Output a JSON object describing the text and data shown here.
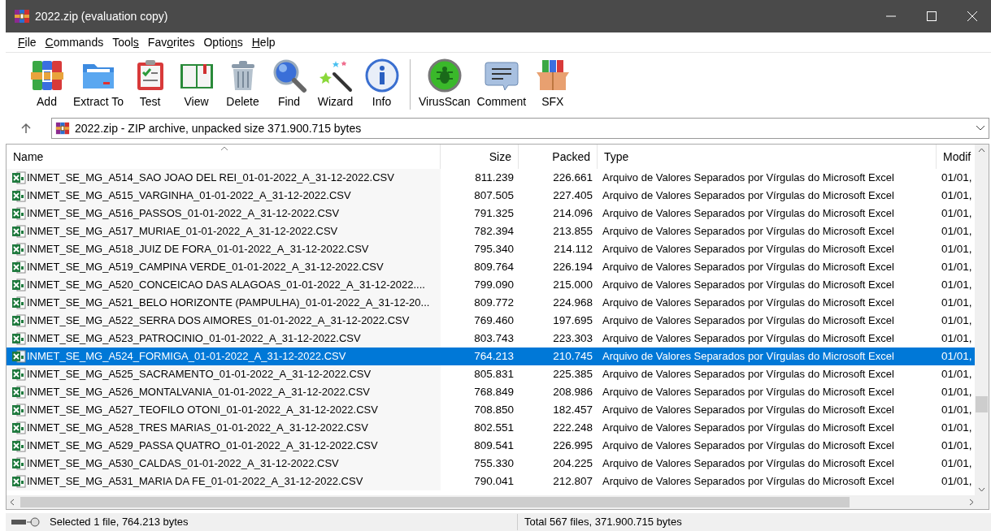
{
  "window": {
    "title": "2022.zip (evaluation copy)"
  },
  "menu": [
    {
      "key": "F",
      "after": "ile"
    },
    {
      "key": "C",
      "after": "ommands"
    },
    {
      "before": "Tool",
      "key": "s"
    },
    {
      "before": "Fav",
      "key": "o",
      "after": "rites"
    },
    {
      "before": "Optio",
      "key": "n",
      "after": "s"
    },
    {
      "key": "H",
      "after": "elp"
    }
  ],
  "toolbar": [
    {
      "kind": "add",
      "label": "Add"
    },
    {
      "kind": "extract",
      "label": "Extract To"
    },
    {
      "kind": "test",
      "label": "Test"
    },
    {
      "kind": "view",
      "label": "View"
    },
    {
      "kind": "delete",
      "label": "Delete"
    },
    {
      "kind": "find",
      "label": "Find"
    },
    {
      "kind": "wizard",
      "label": "Wizard"
    },
    {
      "kind": "info",
      "label": "Info"
    },
    {
      "kind": "separator"
    },
    {
      "kind": "virusscan",
      "label": "VirusScan"
    },
    {
      "kind": "comment",
      "label": "Comment"
    },
    {
      "kind": "sfx",
      "label": "SFX"
    }
  ],
  "address": {
    "text": "2022.zip - ZIP archive, unpacked size 371.900.715 bytes"
  },
  "table": {
    "columns": [
      "Name",
      "Size",
      "Packed",
      "Type",
      "Modif"
    ],
    "rows": [
      {
        "name": "INMET_SE_MG_A514_SAO JOAO DEL REI_01-01-2022_A_31-12-2022.CSV",
        "size": "811.239",
        "packed": "226.661",
        "type": "Arquivo de Valores Separados por Vírgulas do Microsoft Excel",
        "modified": "01/01,",
        "selected": false
      },
      {
        "name": "INMET_SE_MG_A515_VARGINHA_01-01-2022_A_31-12-2022.CSV",
        "size": "807.505",
        "packed": "227.405",
        "type": "Arquivo de Valores Separados por Vírgulas do Microsoft Excel",
        "modified": "01/01,",
        "selected": false
      },
      {
        "name": "INMET_SE_MG_A516_PASSOS_01-01-2022_A_31-12-2022.CSV",
        "size": "791.325",
        "packed": "214.096",
        "type": "Arquivo de Valores Separados por Vírgulas do Microsoft Excel",
        "modified": "01/01,",
        "selected": false
      },
      {
        "name": "INMET_SE_MG_A517_MURIAE_01-01-2022_A_31-12-2022.CSV",
        "size": "782.394",
        "packed": "213.855",
        "type": "Arquivo de Valores Separados por Vírgulas do Microsoft Excel",
        "modified": "01/01,",
        "selected": false
      },
      {
        "name": "INMET_SE_MG_A518_JUIZ DE FORA_01-01-2022_A_31-12-2022.CSV",
        "size": "795.340",
        "packed": "214.112",
        "type": "Arquivo de Valores Separados por Vírgulas do Microsoft Excel",
        "modified": "01/01,",
        "selected": false
      },
      {
        "name": "INMET_SE_MG_A519_CAMPINA VERDE_01-01-2022_A_31-12-2022.CSV",
        "size": "809.764",
        "packed": "226.194",
        "type": "Arquivo de Valores Separados por Vírgulas do Microsoft Excel",
        "modified": "01/01,",
        "selected": false
      },
      {
        "name": "INMET_SE_MG_A520_CONCEICAO DAS ALAGOAS_01-01-2022_A_31-12-2022....",
        "size": "799.090",
        "packed": "215.000",
        "type": "Arquivo de Valores Separados por Vírgulas do Microsoft Excel",
        "modified": "01/01,",
        "selected": false
      },
      {
        "name": "INMET_SE_MG_A521_BELO HORIZONTE (PAMPULHA)_01-01-2022_A_31-12-20...",
        "size": "809.772",
        "packed": "224.968",
        "type": "Arquivo de Valores Separados por Vírgulas do Microsoft Excel",
        "modified": "01/01,",
        "selected": false
      },
      {
        "name": "INMET_SE_MG_A522_SERRA DOS AIMORES_01-01-2022_A_31-12-2022.CSV",
        "size": "769.460",
        "packed": "197.695",
        "type": "Arquivo de Valores Separados por Vírgulas do Microsoft Excel",
        "modified": "01/01,",
        "selected": false
      },
      {
        "name": "INMET_SE_MG_A523_PATROCINIO_01-01-2022_A_31-12-2022.CSV",
        "size": "803.743",
        "packed": "223.303",
        "type": "Arquivo de Valores Separados por Vírgulas do Microsoft Excel",
        "modified": "01/01,",
        "selected": false
      },
      {
        "name": "INMET_SE_MG_A524_FORMIGA_01-01-2022_A_31-12-2022.CSV",
        "size": "764.213",
        "packed": "210.745",
        "type": "Arquivo de Valores Separados por Vírgulas do Microsoft Excel",
        "modified": "01/01,",
        "selected": true
      },
      {
        "name": "INMET_SE_MG_A525_SACRAMENTO_01-01-2022_A_31-12-2022.CSV",
        "size": "805.831",
        "packed": "225.385",
        "type": "Arquivo de Valores Separados por Vírgulas do Microsoft Excel",
        "modified": "01/01,",
        "selected": false
      },
      {
        "name": "INMET_SE_MG_A526_MONTALVANIA_01-01-2022_A_31-12-2022.CSV",
        "size": "768.849",
        "packed": "208.986",
        "type": "Arquivo de Valores Separados por Vírgulas do Microsoft Excel",
        "modified": "01/01,",
        "selected": false
      },
      {
        "name": "INMET_SE_MG_A527_TEOFILO OTONI_01-01-2022_A_31-12-2022.CSV",
        "size": "708.850",
        "packed": "182.457",
        "type": "Arquivo de Valores Separados por Vírgulas do Microsoft Excel",
        "modified": "01/01,",
        "selected": false
      },
      {
        "name": "INMET_SE_MG_A528_TRES MARIAS_01-01-2022_A_31-12-2022.CSV",
        "size": "802.551",
        "packed": "222.248",
        "type": "Arquivo de Valores Separados por Vírgulas do Microsoft Excel",
        "modified": "01/01,",
        "selected": false
      },
      {
        "name": "INMET_SE_MG_A529_PASSA QUATRO_01-01-2022_A_31-12-2022.CSV",
        "size": "809.541",
        "packed": "226.995",
        "type": "Arquivo de Valores Separados por Vírgulas do Microsoft Excel",
        "modified": "01/01,",
        "selected": false
      },
      {
        "name": "INMET_SE_MG_A530_CALDAS_01-01-2022_A_31-12-2022.CSV",
        "size": "755.330",
        "packed": "204.225",
        "type": "Arquivo de Valores Separados por Vírgulas do Microsoft Excel",
        "modified": "01/01,",
        "selected": false
      },
      {
        "name": "INMET_SE_MG_A531_MARIA DA FE_01-01-2022_A_31-12-2022.CSV",
        "size": "790.041",
        "packed": "212.807",
        "type": "Arquivo de Valores Separados por Vírgulas do Microsoft Excel",
        "modified": "01/01,",
        "selected": false
      }
    ]
  },
  "status_bar": {
    "left": "Selected 1 file, 764.213 bytes",
    "right": "Total 567 files, 371.900.715 bytes"
  }
}
